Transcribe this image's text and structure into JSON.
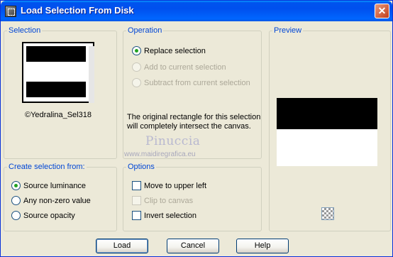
{
  "window": {
    "title": "Load Selection From Disk",
    "close_label": "✕",
    "accent": "#0046d5",
    "title_bar_color": "#0054e3"
  },
  "selection_group": {
    "label": "Selection",
    "selection_name": "©Yedralina_Sel318"
  },
  "operation_group": {
    "label": "Operation",
    "options": [
      {
        "label": "Replace selection",
        "checked": true,
        "enabled": true
      },
      {
        "label": "Add to current selection",
        "checked": false,
        "enabled": false
      },
      {
        "label": "Subtract from current selection",
        "checked": false,
        "enabled": false
      }
    ],
    "note": "The original rectangle for this selection will completely intersect the canvas."
  },
  "preview_group": {
    "label": "Preview",
    "transparency_icon": "checkerboard-icon"
  },
  "create_group": {
    "label": "Create selection from:",
    "options": [
      {
        "label": "Source luminance",
        "checked": true
      },
      {
        "label": "Any non-zero value",
        "checked": false
      },
      {
        "label": "Source opacity",
        "checked": false
      }
    ]
  },
  "options_group": {
    "label": "Options",
    "items": [
      {
        "label": "Move to upper left",
        "checked": false,
        "enabled": true
      },
      {
        "label": "Clip to canvas",
        "checked": false,
        "enabled": false
      },
      {
        "label": "Invert selection",
        "checked": false,
        "enabled": true
      }
    ]
  },
  "watermark": {
    "name": "Pinuccia",
    "url": "www.maidiregrafica.eu"
  },
  "buttons": {
    "load": "Load",
    "cancel": "Cancel",
    "help": "Help"
  }
}
